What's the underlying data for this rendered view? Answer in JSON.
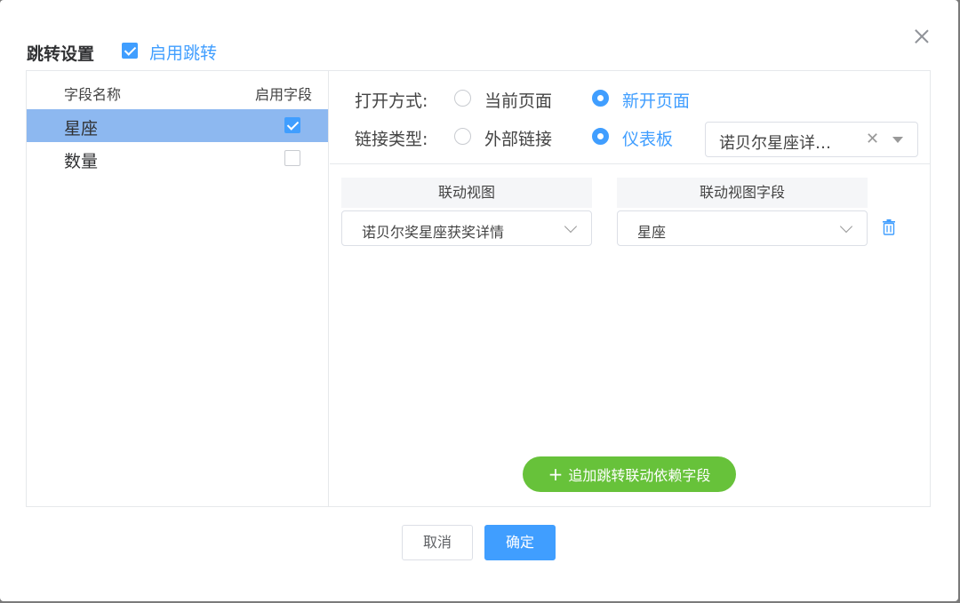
{
  "dialog": {
    "title": "跳转设置",
    "enable_jump_label": "启用跳转",
    "enable_jump_checked": true
  },
  "field_table": {
    "col_name": "字段名称",
    "col_enable": "启用字段",
    "rows": [
      {
        "name": "星座",
        "enabled": true,
        "selected": true
      },
      {
        "name": "数量",
        "enabled": false,
        "selected": false
      }
    ]
  },
  "open_mode": {
    "label": "打开方式:",
    "options": [
      "当前页面",
      "新开页面"
    ],
    "selected": "新开页面"
  },
  "link_type": {
    "label": "链接类型:",
    "options": [
      "外部链接",
      "仪表板"
    ],
    "selected": "仪表板",
    "dashboard_value": "诺贝尔星座详…"
  },
  "linkage": {
    "col_view": "联动视图",
    "col_field": "联动视图字段",
    "rows": [
      {
        "view": "诺贝尔奖星座获奖详情",
        "field": "星座"
      }
    ]
  },
  "add_button_label": "追加跳转联动依赖字段",
  "footer": {
    "cancel_label": "取消",
    "ok_label": "确定"
  },
  "colors": {
    "primary": "#409eff",
    "success": "#67c23a",
    "selected_row": "#8db8f0"
  }
}
